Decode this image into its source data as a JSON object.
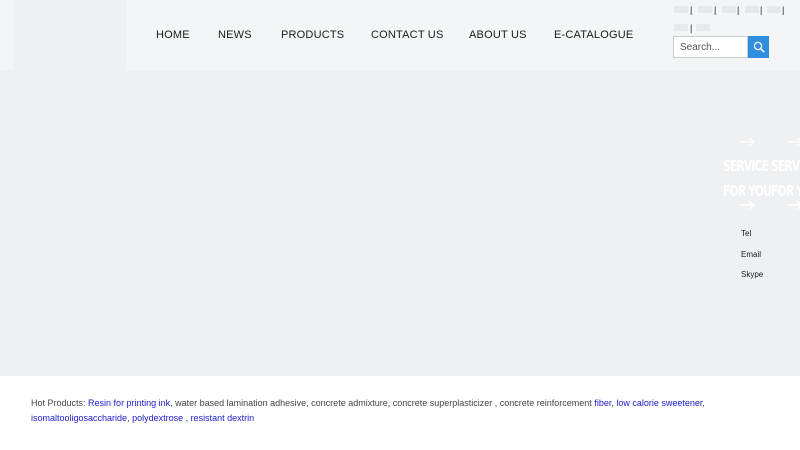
{
  "nav": {
    "items": [
      "HOME",
      "NEWS",
      "PRODUCTS",
      "CONTACT US",
      "ABOUT US",
      "E-CATALOGUE"
    ]
  },
  "language": {
    "separator": "|"
  },
  "search": {
    "placeholder": "Search..."
  },
  "hero": {
    "service_line1": "SERVICE",
    "service_line2": "FOR YOU",
    "contact_labels": [
      "Tel",
      "Email",
      "Skype"
    ]
  },
  "footer": {
    "hot_label": "Hot Products:",
    "link_resin": "Resin for printing ink",
    "plain_1": ", water based lamination adhesive, concrete admixture, concrete superplasticizer , concrete reinforcement ",
    "link_fiber": "fiber",
    "sep_1": ", ",
    "link_sweetener": "low calorie sweetener",
    "sep_2": ",",
    "link_iso": "isomaltooligosaccharide",
    "sep_3": ", ",
    "link_poly": "polydextrose",
    "sep_4": " , ",
    "link_dextrin": "resistant dextrin"
  },
  "colors": {
    "header_bg": "#f4f5f7",
    "hero_bg": "#eff0f2",
    "accent": "#2f8ede",
    "link": "#1a1acb"
  }
}
